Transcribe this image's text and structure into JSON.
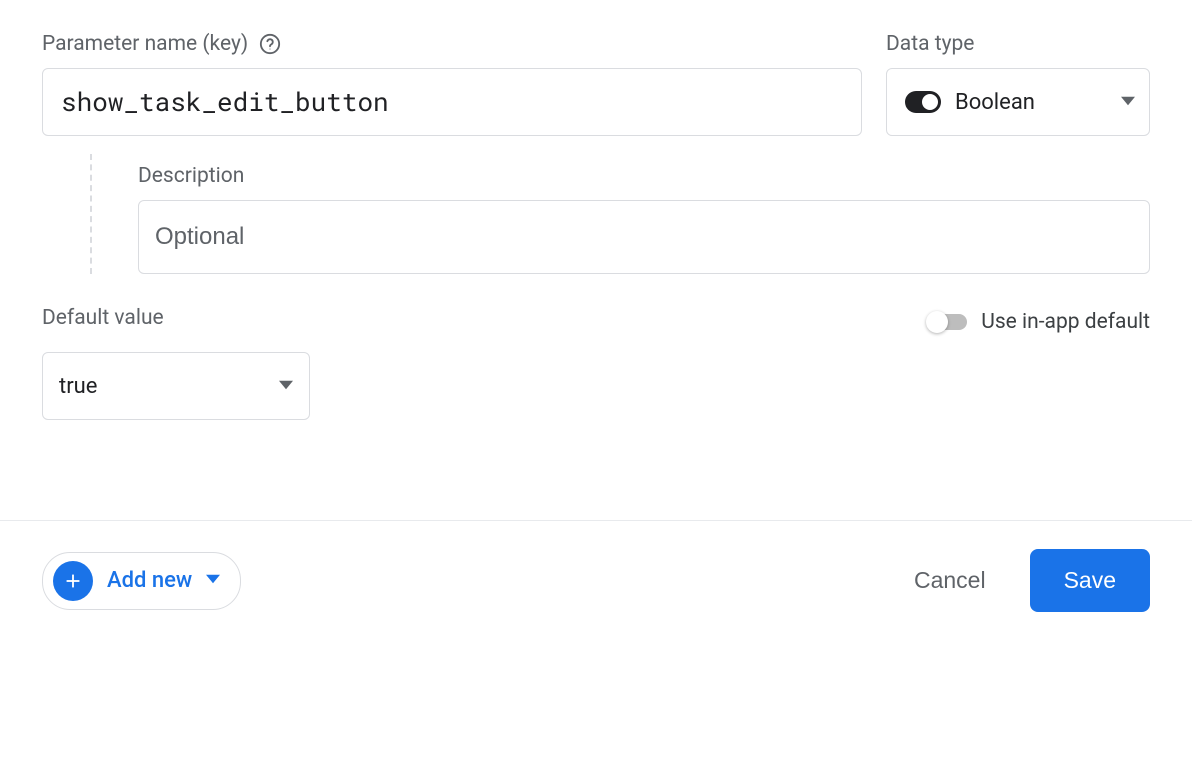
{
  "parameter": {
    "name_label": "Parameter name (key)",
    "name_value": "show_task_edit_button"
  },
  "data_type": {
    "label": "Data type",
    "selected": "Boolean"
  },
  "description": {
    "label": "Description",
    "placeholder": "Optional",
    "value": ""
  },
  "default_value": {
    "label": "Default value",
    "selected": "true"
  },
  "inapp_default": {
    "label": "Use in-app default",
    "enabled": false
  },
  "footer": {
    "add_new_label": "Add new",
    "cancel_label": "Cancel",
    "save_label": "Save"
  }
}
